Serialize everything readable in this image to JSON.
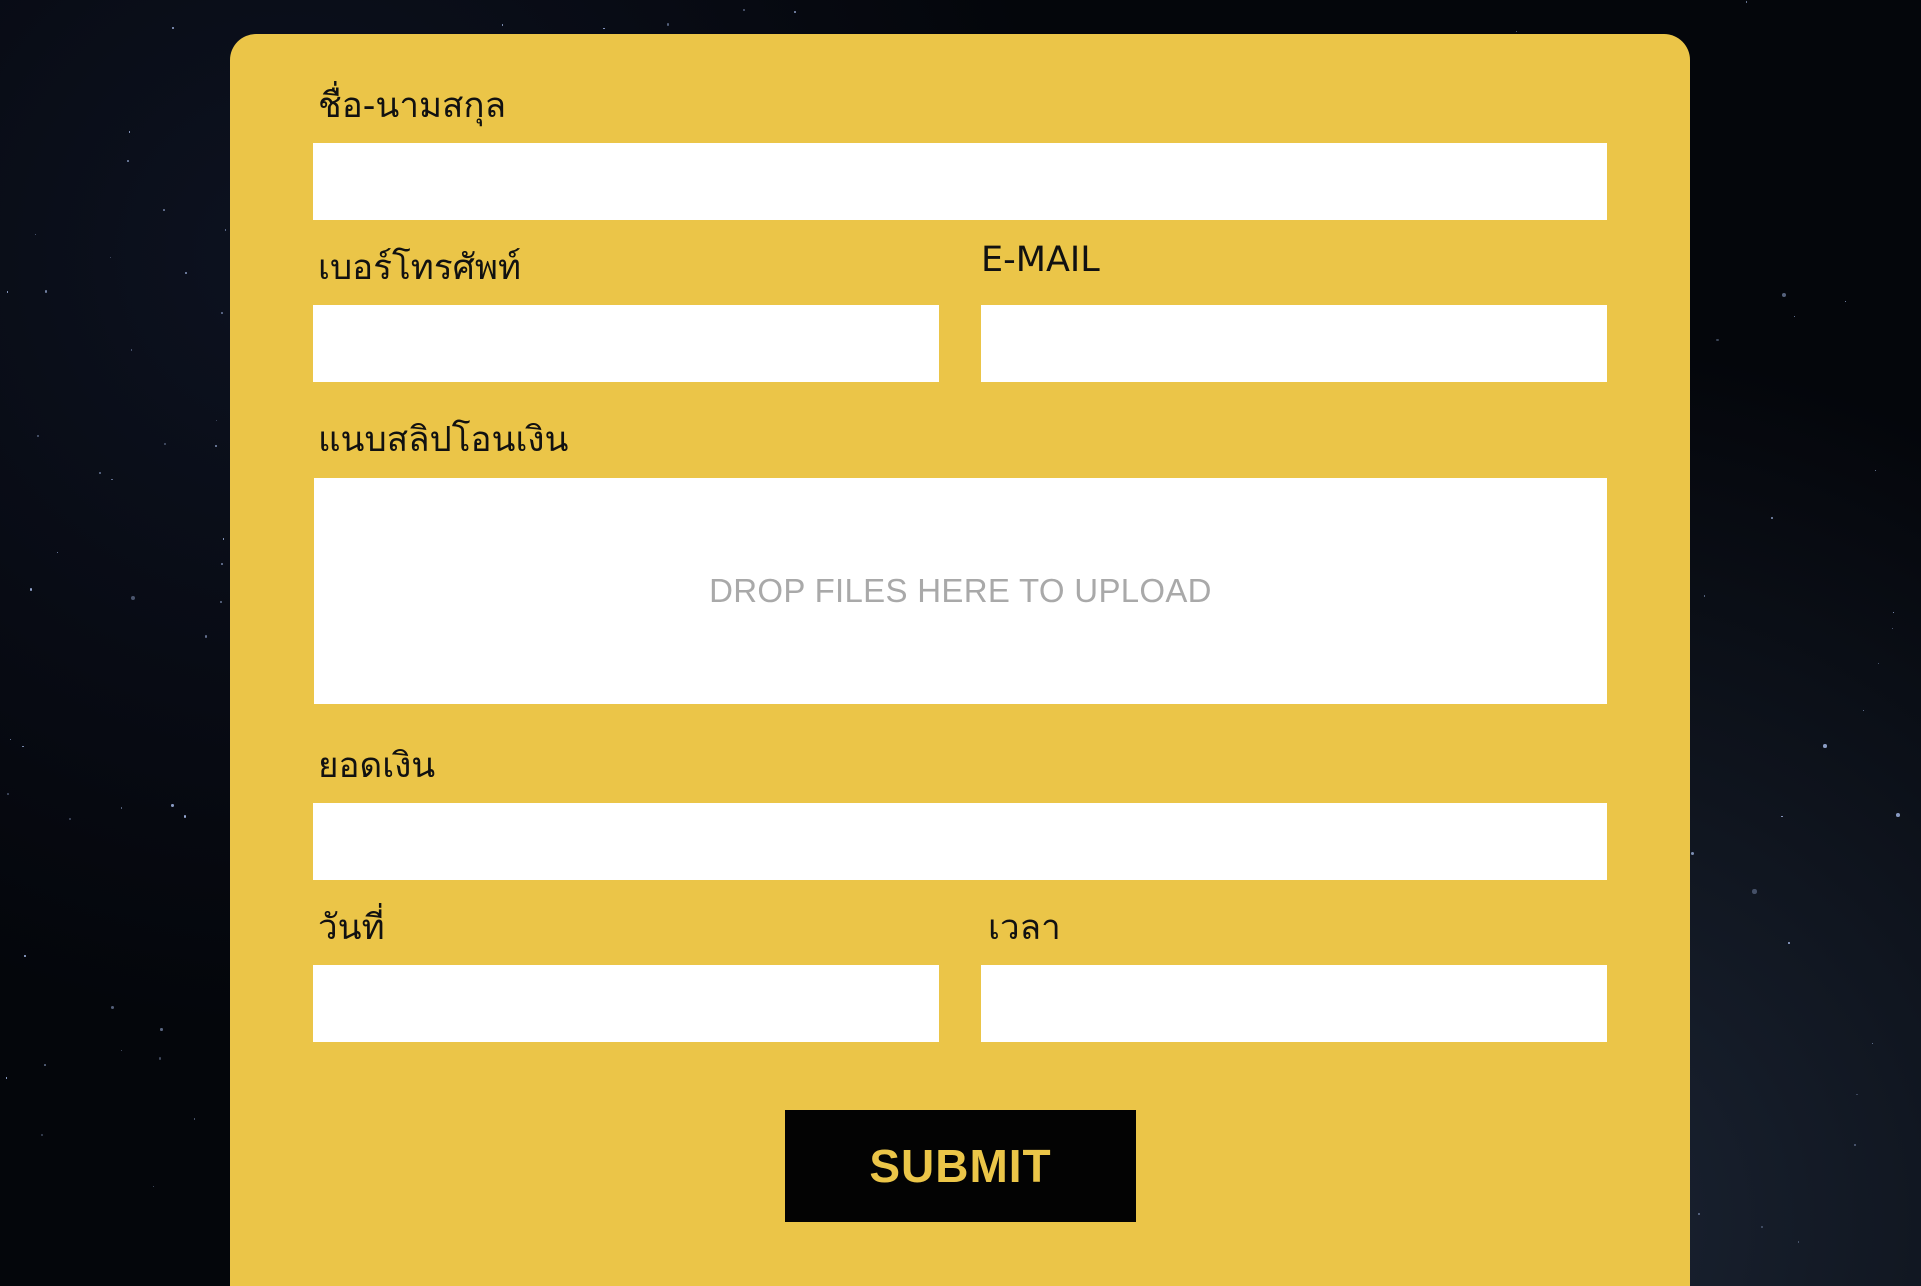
{
  "form": {
    "fields": {
      "full_name": {
        "label": "ชื่อ-นามสกุล",
        "value": ""
      },
      "phone": {
        "label": "เบอร์โทรศัพท์",
        "value": ""
      },
      "email": {
        "label": "E-MAIL",
        "value": ""
      },
      "slip": {
        "label": "แนบสลิปโอนเงิน",
        "drop_text": "DROP FILES HERE TO UPLOAD"
      },
      "amount": {
        "label": "ยอดเงิน",
        "value": ""
      },
      "date": {
        "label": "วันที่",
        "value": ""
      },
      "time": {
        "label": "เวลา",
        "value": ""
      }
    },
    "submit_label": "SUBMIT"
  },
  "colors": {
    "panel": "#ebc548",
    "input": "#ffffff",
    "button": "#030303",
    "button_text": "#ebc548",
    "background": "#04060b"
  }
}
